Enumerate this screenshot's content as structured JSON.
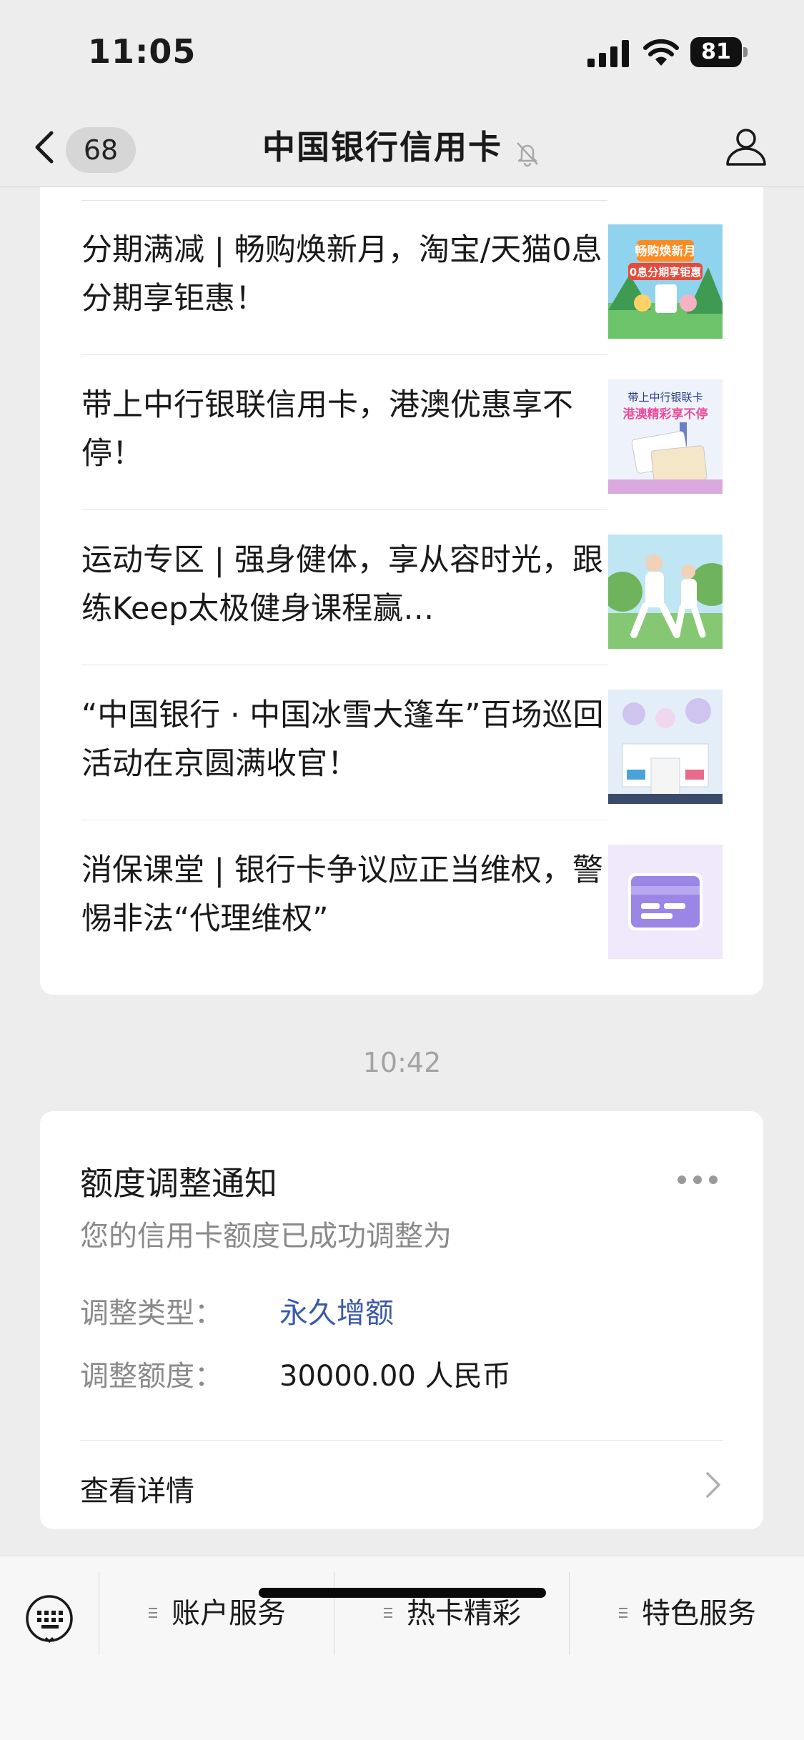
{
  "status_bar": {
    "time": "11:05",
    "battery_level": "81"
  },
  "nav": {
    "unread_count": "68",
    "title": "中国银行信用卡"
  },
  "articles": [
    {
      "title": "分期满减 | 畅购焕新月，淘宝/天猫0息分期享钜惠！",
      "thumb_caption_1": "畅购焕新月",
      "thumb_caption_2": "0息分期享钜惠"
    },
    {
      "title": "带上中行银联信用卡，港澳优惠享不停！",
      "thumb_caption_1": "带上中行银联卡",
      "thumb_caption_2": "港澳精彩享不停"
    },
    {
      "title": "运动专区 | 强身健体，享从容时光，跟练Keep太极健身课程赢…"
    },
    {
      "title": "“中国银行 · 中国冰雪大篷车”百场巡回活动在京圆满收官！"
    },
    {
      "title": "消保课堂 | 银行卡争议应正当维权，警惕非法“代理维权”"
    }
  ],
  "timestamp": "10:42",
  "notice": {
    "title": "额度调整通知",
    "subtitle": "您的信用卡额度已成功调整为",
    "rows": [
      {
        "label": "调整类型：",
        "value": "永久增额"
      },
      {
        "label": "调整额度：",
        "value": "30000.00 人民币"
      }
    ],
    "details_label": "查看详情"
  },
  "menu": {
    "items": [
      {
        "label": "账户服务"
      },
      {
        "label": "热卡精彩"
      },
      {
        "label": "特色服务"
      }
    ]
  },
  "colors": {
    "background": "#ededed",
    "card": "#ffffff",
    "link_blue": "#3b5aa6",
    "muted_text": "#8a8a8a"
  }
}
